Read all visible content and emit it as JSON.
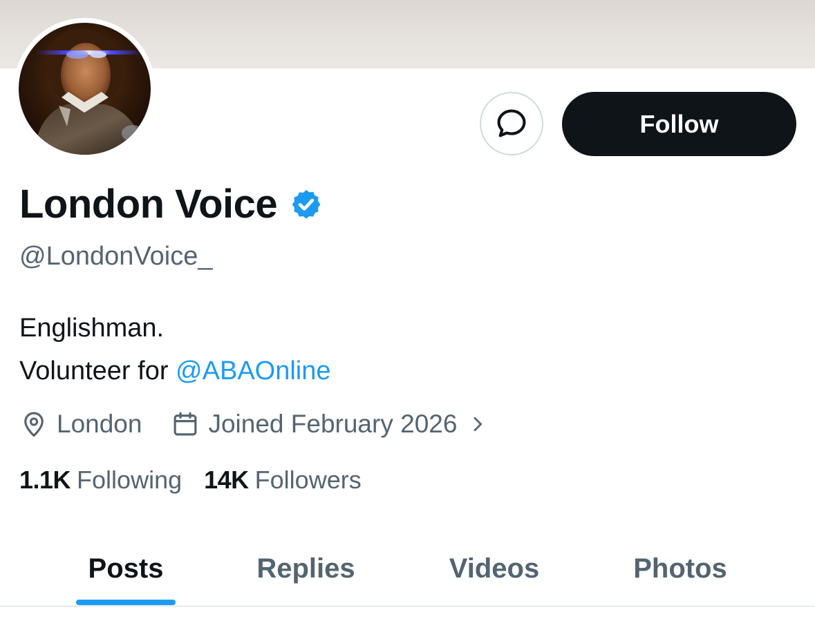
{
  "profile": {
    "display_name": "London Voice",
    "handle": "@LondonVoice_",
    "verified": true,
    "bio_line1": "Englishman.",
    "bio_line2_prefix": "Volunteer for ",
    "bio_mention": "@ABAOnline",
    "location": "London",
    "joined": "Joined February 2026",
    "following_count": "1.1K",
    "following_label": "Following",
    "followers_count": "14K",
    "followers_label": "Followers"
  },
  "actions": {
    "follow_label": "Follow",
    "message_icon": "message-bubble-icon"
  },
  "tabs": [
    {
      "label": "Posts",
      "active": true
    },
    {
      "label": "Replies",
      "active": false
    },
    {
      "label": "Videos",
      "active": false
    },
    {
      "label": "Photos",
      "active": false
    }
  ],
  "icons": {
    "location": "location-pin-icon",
    "joined": "calendar-icon",
    "joined_more": "chevron-right-icon",
    "verified": "verified-badge-icon"
  },
  "colors": {
    "accent": "#1d9bf0",
    "text_primary": "#0f1419",
    "text_secondary": "#536471",
    "follow_button_bg": "#0f1419",
    "border": "#cfd9de"
  }
}
